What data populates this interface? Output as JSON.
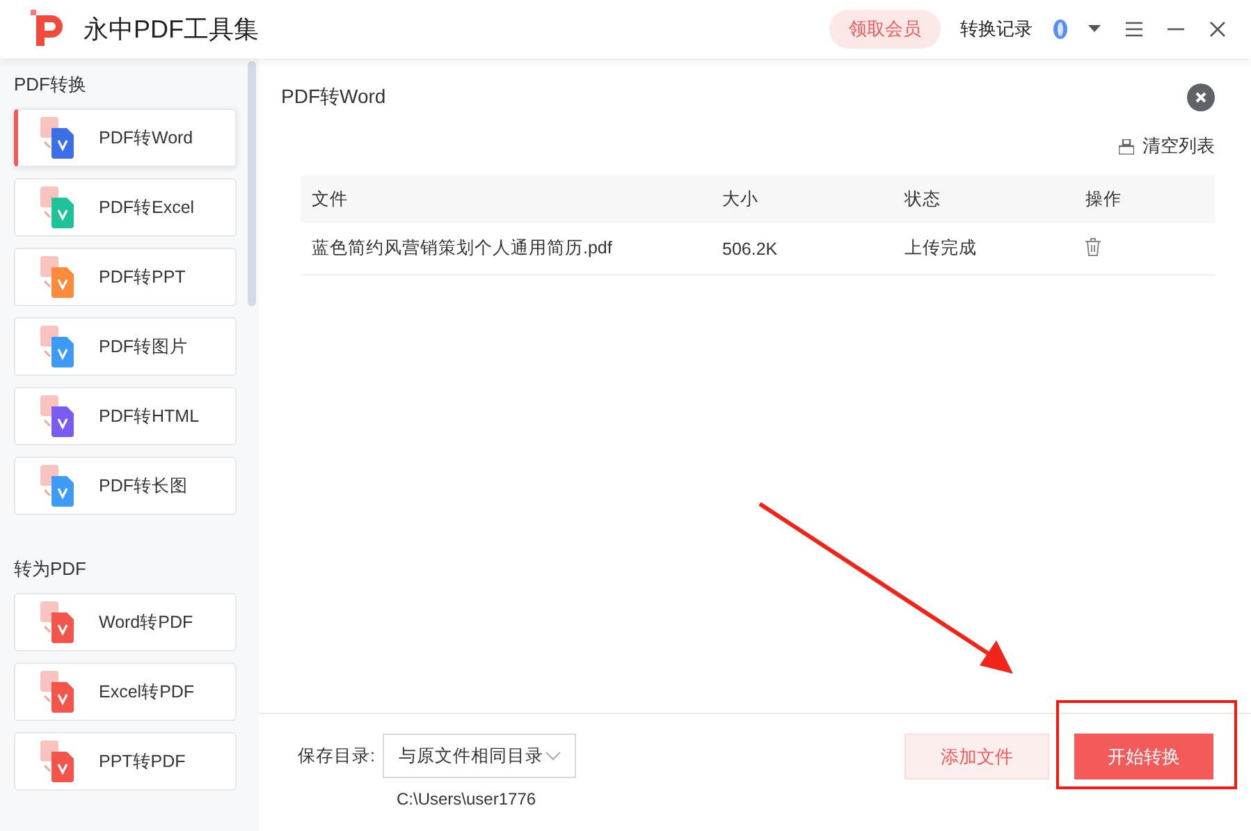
{
  "window": {
    "title": "永中PDF工具集",
    "vip_button": "领取会员",
    "history_link": "转换记录"
  },
  "sidebar": {
    "groups": [
      {
        "title": "PDF转换",
        "items": [
          {
            "label": "PDF转Word",
            "color": "#3c6ee8",
            "selected": true
          },
          {
            "label": "PDF转Excel",
            "color": "#1fc39a",
            "selected": false
          },
          {
            "label": "PDF转PPT",
            "color": "#fb8b3c",
            "selected": false
          },
          {
            "label": "PDF转图片",
            "color": "#3d9af5",
            "selected": false
          },
          {
            "label": "PDF转HTML",
            "color": "#7a5cf0",
            "selected": false
          },
          {
            "label": "PDF转长图",
            "color": "#3d9af5",
            "selected": false
          }
        ]
      },
      {
        "title": "转为PDF",
        "items": [
          {
            "label": "Word转PDF",
            "color": "#f2554a",
            "selected": false
          },
          {
            "label": "Excel转PDF",
            "color": "#f2554a",
            "selected": false
          },
          {
            "label": "PPT转PDF",
            "color": "#f2554a",
            "selected": false
          }
        ]
      }
    ]
  },
  "panel": {
    "title": "PDF转Word",
    "clear_list": "清空列表",
    "table": {
      "columns": [
        "文件",
        "大小",
        "状态",
        "操作"
      ],
      "rows": [
        {
          "file": "蓝色简约风营销策划个人通用简历.pdf",
          "size": "506.2K",
          "status": "上传完成"
        }
      ]
    },
    "save_label": "保存目录:",
    "save_select": "与原文件相同目录",
    "save_path": "C:\\Users\\user1776",
    "add_button": "添加文件",
    "start_button": "开始转换"
  }
}
